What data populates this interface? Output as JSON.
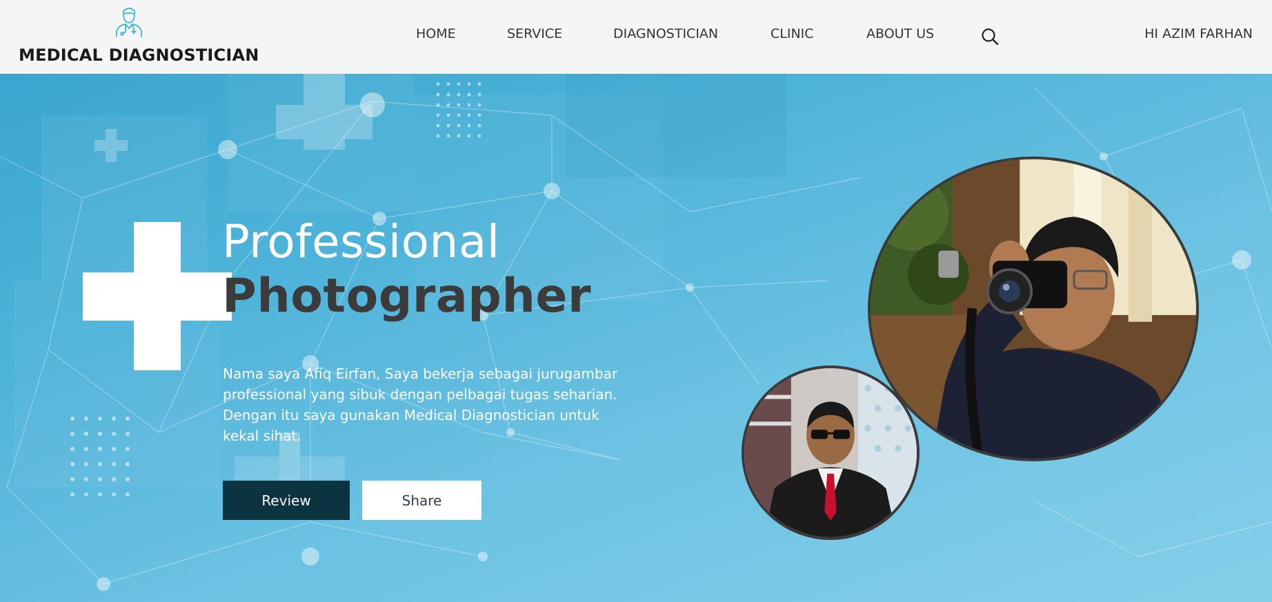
{
  "header": {
    "brand_name": "MEDICAL DIAGNOSTICIAN",
    "brand_icon": "doctor-icon",
    "nav": [
      {
        "label": "HOME"
      },
      {
        "label": "SERVICE"
      },
      {
        "label": "DIAGNOSTICIAN"
      },
      {
        "label": "CLINIC"
      },
      {
        "label": "ABOUT US"
      }
    ],
    "search_icon": "search-icon",
    "greeting": "HI AZIM FARHAN"
  },
  "hero": {
    "title_line1": "Professional",
    "title_line2": "Photographer",
    "description": "Nama saya Afiq Eirfan, Saya bekerja sebagai jurugambar professional yang sibuk dengan pelbagai tugas seharian. Dengan itu saya gunakan Medical Diagnostician untuk kekal sihat.",
    "review_label": "Review",
    "share_label": "Share"
  },
  "colors": {
    "accent": "#3ab4e0",
    "hero_bg": "#4eb3d9",
    "dark_button": "#0b3340",
    "title_dark": "#3b3b3b"
  }
}
